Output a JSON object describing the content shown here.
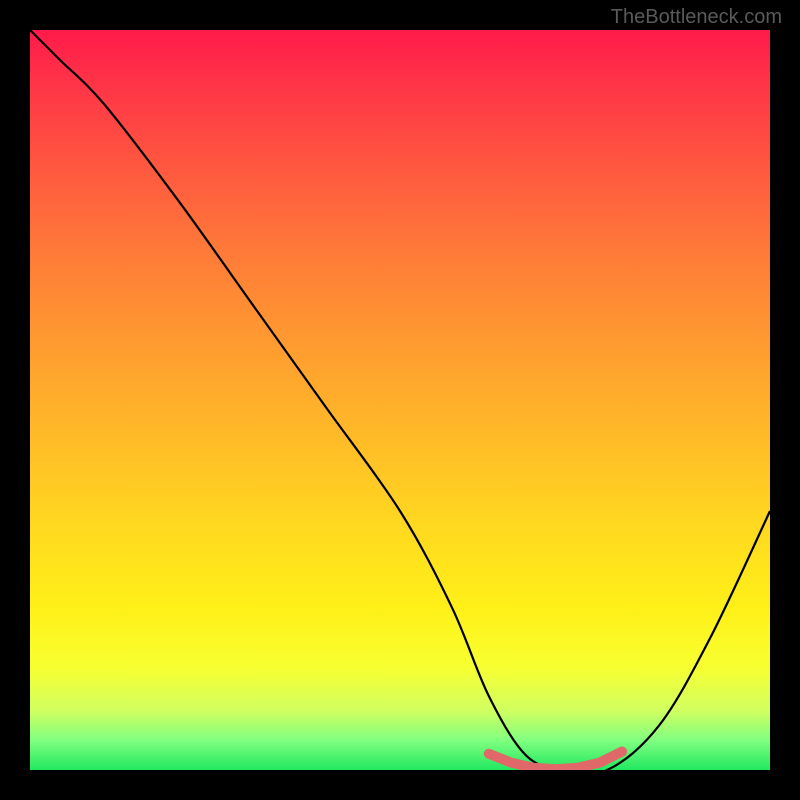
{
  "watermark": "TheBottleneck.com",
  "chart_data": {
    "type": "line",
    "title": "",
    "xlabel": "",
    "ylabel": "",
    "xlim": [
      0,
      100
    ],
    "ylim": [
      0,
      100
    ],
    "series": [
      {
        "name": "bottleneck-curve",
        "x": [
          0,
          4,
          10,
          20,
          30,
          40,
          50,
          57,
          62,
          67,
          72,
          78,
          85,
          92,
          100
        ],
        "y": [
          100,
          96,
          90,
          77,
          63,
          49,
          35,
          22,
          10,
          2,
          0,
          0,
          6,
          18,
          35
        ]
      }
    ],
    "highlight": {
      "name": "optimal-range",
      "x": [
        62,
        65,
        68,
        71,
        74,
        77,
        80
      ],
      "y": [
        2.2,
        1.0,
        0.3,
        0.1,
        0.3,
        1.0,
        2.5
      ]
    },
    "gradient_stops": [
      {
        "pos": 0,
        "color": "#ff1a4a"
      },
      {
        "pos": 18,
        "color": "#ff5640"
      },
      {
        "pos": 42,
        "color": "#ff9a30"
      },
      {
        "pos": 66,
        "color": "#ffd620"
      },
      {
        "pos": 86,
        "color": "#f8ff30"
      },
      {
        "pos": 100,
        "color": "#20e860"
      }
    ]
  }
}
